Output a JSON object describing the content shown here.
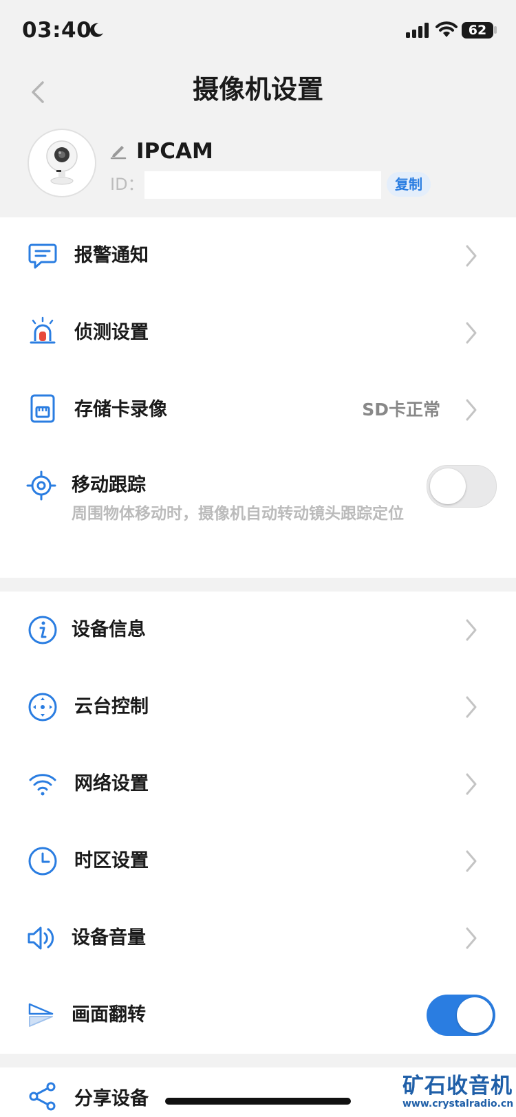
{
  "status_bar": {
    "time": "03:40",
    "battery": "62"
  },
  "nav": {
    "title": "摄像机设置"
  },
  "device": {
    "name": "IPCAM",
    "id_label": "ID：",
    "copy_label": "复制"
  },
  "group1": [
    {
      "label": "报警通知",
      "icon": "alarm-message-icon"
    },
    {
      "label": "侦测设置",
      "icon": "siren-icon"
    },
    {
      "label": "存储卡录像",
      "value": "SD卡正常",
      "icon": "sd-card-icon"
    },
    {
      "label": "移动跟踪",
      "desc": "周围物体移动时，摄像机自动转动镜头跟踪定位",
      "icon": "target-icon",
      "toggle": false
    }
  ],
  "group2": [
    {
      "label": "设备信息",
      "icon": "info-icon"
    },
    {
      "label": "云台控制",
      "icon": "ptz-control-icon"
    },
    {
      "label": "网络设置",
      "icon": "wifi-icon"
    },
    {
      "label": "时区设置",
      "icon": "clock-icon"
    },
    {
      "label": "设备音量",
      "icon": "volume-icon"
    },
    {
      "label": "画面翻转",
      "icon": "flip-icon",
      "toggle": true
    }
  ],
  "group3": [
    {
      "label": "分享设备",
      "icon": "share-icon"
    }
  ],
  "watermark": {
    "title": "矿石收音机",
    "url": "www.crystalradio.cn"
  },
  "colors": {
    "accent": "#2a7de1",
    "background": "#f2f2f2",
    "alarm_red": "#e84a3a"
  }
}
